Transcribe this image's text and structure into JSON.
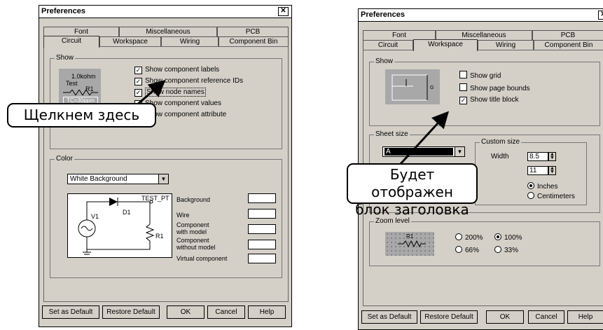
{
  "left_dialog": {
    "title": "Preferences",
    "tabs_top": [
      "Font",
      "Miscellaneous",
      "PCB"
    ],
    "tabs_bottom": [
      "Circuit",
      "Workspace",
      "Wiring",
      "Component Bin"
    ],
    "show_group_label": "Show",
    "preview_text": [
      "1.0kohm",
      "Test",
      "R1",
      "TC=30ppm"
    ],
    "show_options": [
      {
        "label": "Show component labels",
        "checked": true
      },
      {
        "label": "Show component reference IDs",
        "checked": true
      },
      {
        "label": "Show node names",
        "checked": true
      },
      {
        "label": "Show component values",
        "checked": true
      },
      {
        "label": "Show component attribute",
        "checked": true
      }
    ],
    "color_group_label": "Color",
    "color_select_value": "White Background",
    "circuit_labels": {
      "test_pt": "TEST_PT",
      "d1": "D1",
      "v1": "V1",
      "r1": "R1"
    },
    "color_items": [
      "Background",
      "Wire",
      "Component\nwith model",
      "Component\nwithout model",
      "Virtual component"
    ],
    "buttons": [
      "Set as Default",
      "Restore Default",
      "OK",
      "Cancel",
      "Help"
    ],
    "callout": "Щелкнем здесь"
  },
  "right_dialog": {
    "title": "Preferences",
    "tabs_top": [
      "Font",
      "Miscellaneous",
      "PCB"
    ],
    "tabs_bottom": [
      "Circuit",
      "Workspace",
      "Wiring",
      "Component Bin"
    ],
    "show_group_label": "Show",
    "show_options": [
      {
        "label": "Show grid",
        "checked": false
      },
      {
        "label": "Show page bounds",
        "checked": false
      },
      {
        "label": "Show title block",
        "checked": true
      }
    ],
    "sheet_group_label": "Sheet size",
    "sheet_select_value": "A",
    "custom_size_label": "Custom size",
    "width_label": "Width",
    "width_value": "8.5",
    "height_value": "11",
    "unit_options": [
      {
        "label": "Inches",
        "selected": true
      },
      {
        "label": "Centimeters",
        "selected": false
      }
    ],
    "zoom_group_label": "Zoom level",
    "zoom_preview_label": "R1",
    "zoom_options": [
      {
        "label": "200%",
        "selected": false
      },
      {
        "label": "100%",
        "selected": true
      },
      {
        "label": "66%",
        "selected": false
      },
      {
        "label": "33%",
        "selected": false
      }
    ],
    "buttons": [
      "Set as Default",
      "Restore Default",
      "OK",
      "Cancel",
      "Help"
    ],
    "callout_line1": "Будет отображен",
    "callout_line2": "блок заголовка"
  }
}
